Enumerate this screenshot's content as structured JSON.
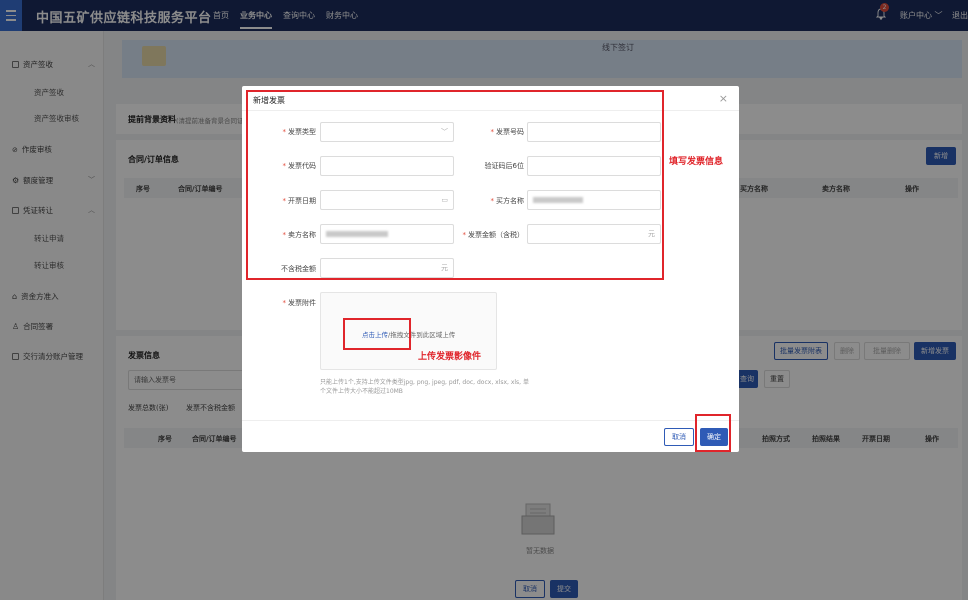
{
  "header": {
    "brand": "中国五矿供应链科技服务平台",
    "nav": [
      "首页",
      "业务中心",
      "查询中心",
      "财务中心"
    ],
    "nav_active": 1,
    "notification_count": "2",
    "account_label": "账户中心",
    "extra_label": "退出"
  },
  "sidebar": {
    "items": [
      {
        "label": "资产签收",
        "icon": "asset-icon",
        "caret": "up"
      },
      {
        "label": "资产签收",
        "sub": true
      },
      {
        "label": "资产签收审核",
        "sub": true
      },
      {
        "label": "作废审核",
        "icon": "link-icon"
      },
      {
        "label": "额度管理",
        "icon": "gear-icon",
        "caret": "down"
      },
      {
        "label": "凭证转让",
        "icon": "doc-icon",
        "caret": "up"
      },
      {
        "label": "转让申请",
        "sub": true
      },
      {
        "label": "转让审核",
        "sub": true
      },
      {
        "label": "资金方准入",
        "icon": "bank-icon"
      },
      {
        "label": "合同签署",
        "icon": "user-icon"
      },
      {
        "label": "交行清分账户管理",
        "icon": "list-icon"
      }
    ]
  },
  "banner": {
    "text": "线下签订"
  },
  "background": {
    "section1_title": "提前背景资料",
    "section1_sub": "(清提前准备背景合同证",
    "contract_title": "合同/订单信息",
    "contract_add": "新增",
    "contract_headers": [
      "序号",
      "合同/订单编号",
      "买方名称",
      "卖方名称",
      "操作"
    ],
    "invoice_title": "发票信息",
    "invoice_buttons": [
      "批量发票附表",
      "删除",
      "批量删除",
      "新增发票"
    ],
    "invoice_search_placeholder": "请输入发票号",
    "search_btn": "查询",
    "reset_btn": "重置",
    "invoice_total_label": "发票总数(张)",
    "invoice_nontax_label": "发票不含税金额",
    "invoice_headers": [
      "序号",
      "合同/订单编号",
      "拍照方式",
      "拍照结果",
      "开票日期",
      "操作"
    ],
    "empty_text": "暂无数据",
    "bottom_cancel": "取消",
    "bottom_submit": "提交"
  },
  "modal": {
    "title": "新增发票",
    "fields": {
      "invoice_type": "发票类型",
      "invoice_number": "发票号码",
      "invoice_code": "发票代码",
      "check_code": "验证码后6位",
      "issue_date": "开票日期",
      "buyer_name": "买方名称",
      "seller_name": "卖方名称",
      "amount_tax": "发票金额（含税）",
      "amount_notax": "不含税金额",
      "attachment": "发票附件"
    },
    "currency_suffix": "元",
    "upload_link": "点击上传",
    "upload_rest": "/拖拽文件到此区域上传",
    "upload_hint": "只能上传1个,支持上传文件类型jpg, png, jpeg, pdf, doc, docx, xlsx, xls, 单个文件上传大小不能超过10MB",
    "cancel": "取消",
    "confirm": "确定"
  },
  "annotations": {
    "fill_info": "填写发票信息",
    "upload_image": "上传发票影像件"
  },
  "colors": {
    "topbar": "#1c2d5e",
    "primary": "#2f5bb6",
    "annotation_red": "#e0252b"
  }
}
